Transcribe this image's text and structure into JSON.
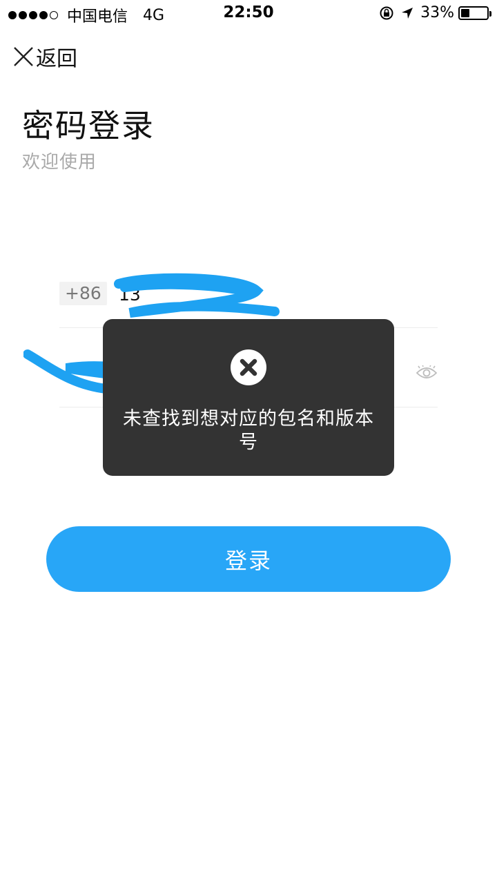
{
  "status_bar": {
    "carrier": "中国电信",
    "network": "4G",
    "time": "22:50",
    "battery_percent": "33%",
    "battery_level": 0.33
  },
  "nav": {
    "back_label": "返回"
  },
  "header": {
    "title": "密码登录",
    "subtitle": "欢迎使用"
  },
  "form": {
    "country_code": "+86",
    "phone_value": "13",
    "password_value": ""
  },
  "login_button": {
    "label": "登录"
  },
  "toast": {
    "message": "未查找到想对应的包名和版本号"
  },
  "colors": {
    "accent": "#28a6f7",
    "toast_bg": "#333333",
    "redaction": "#1ea2f2"
  }
}
